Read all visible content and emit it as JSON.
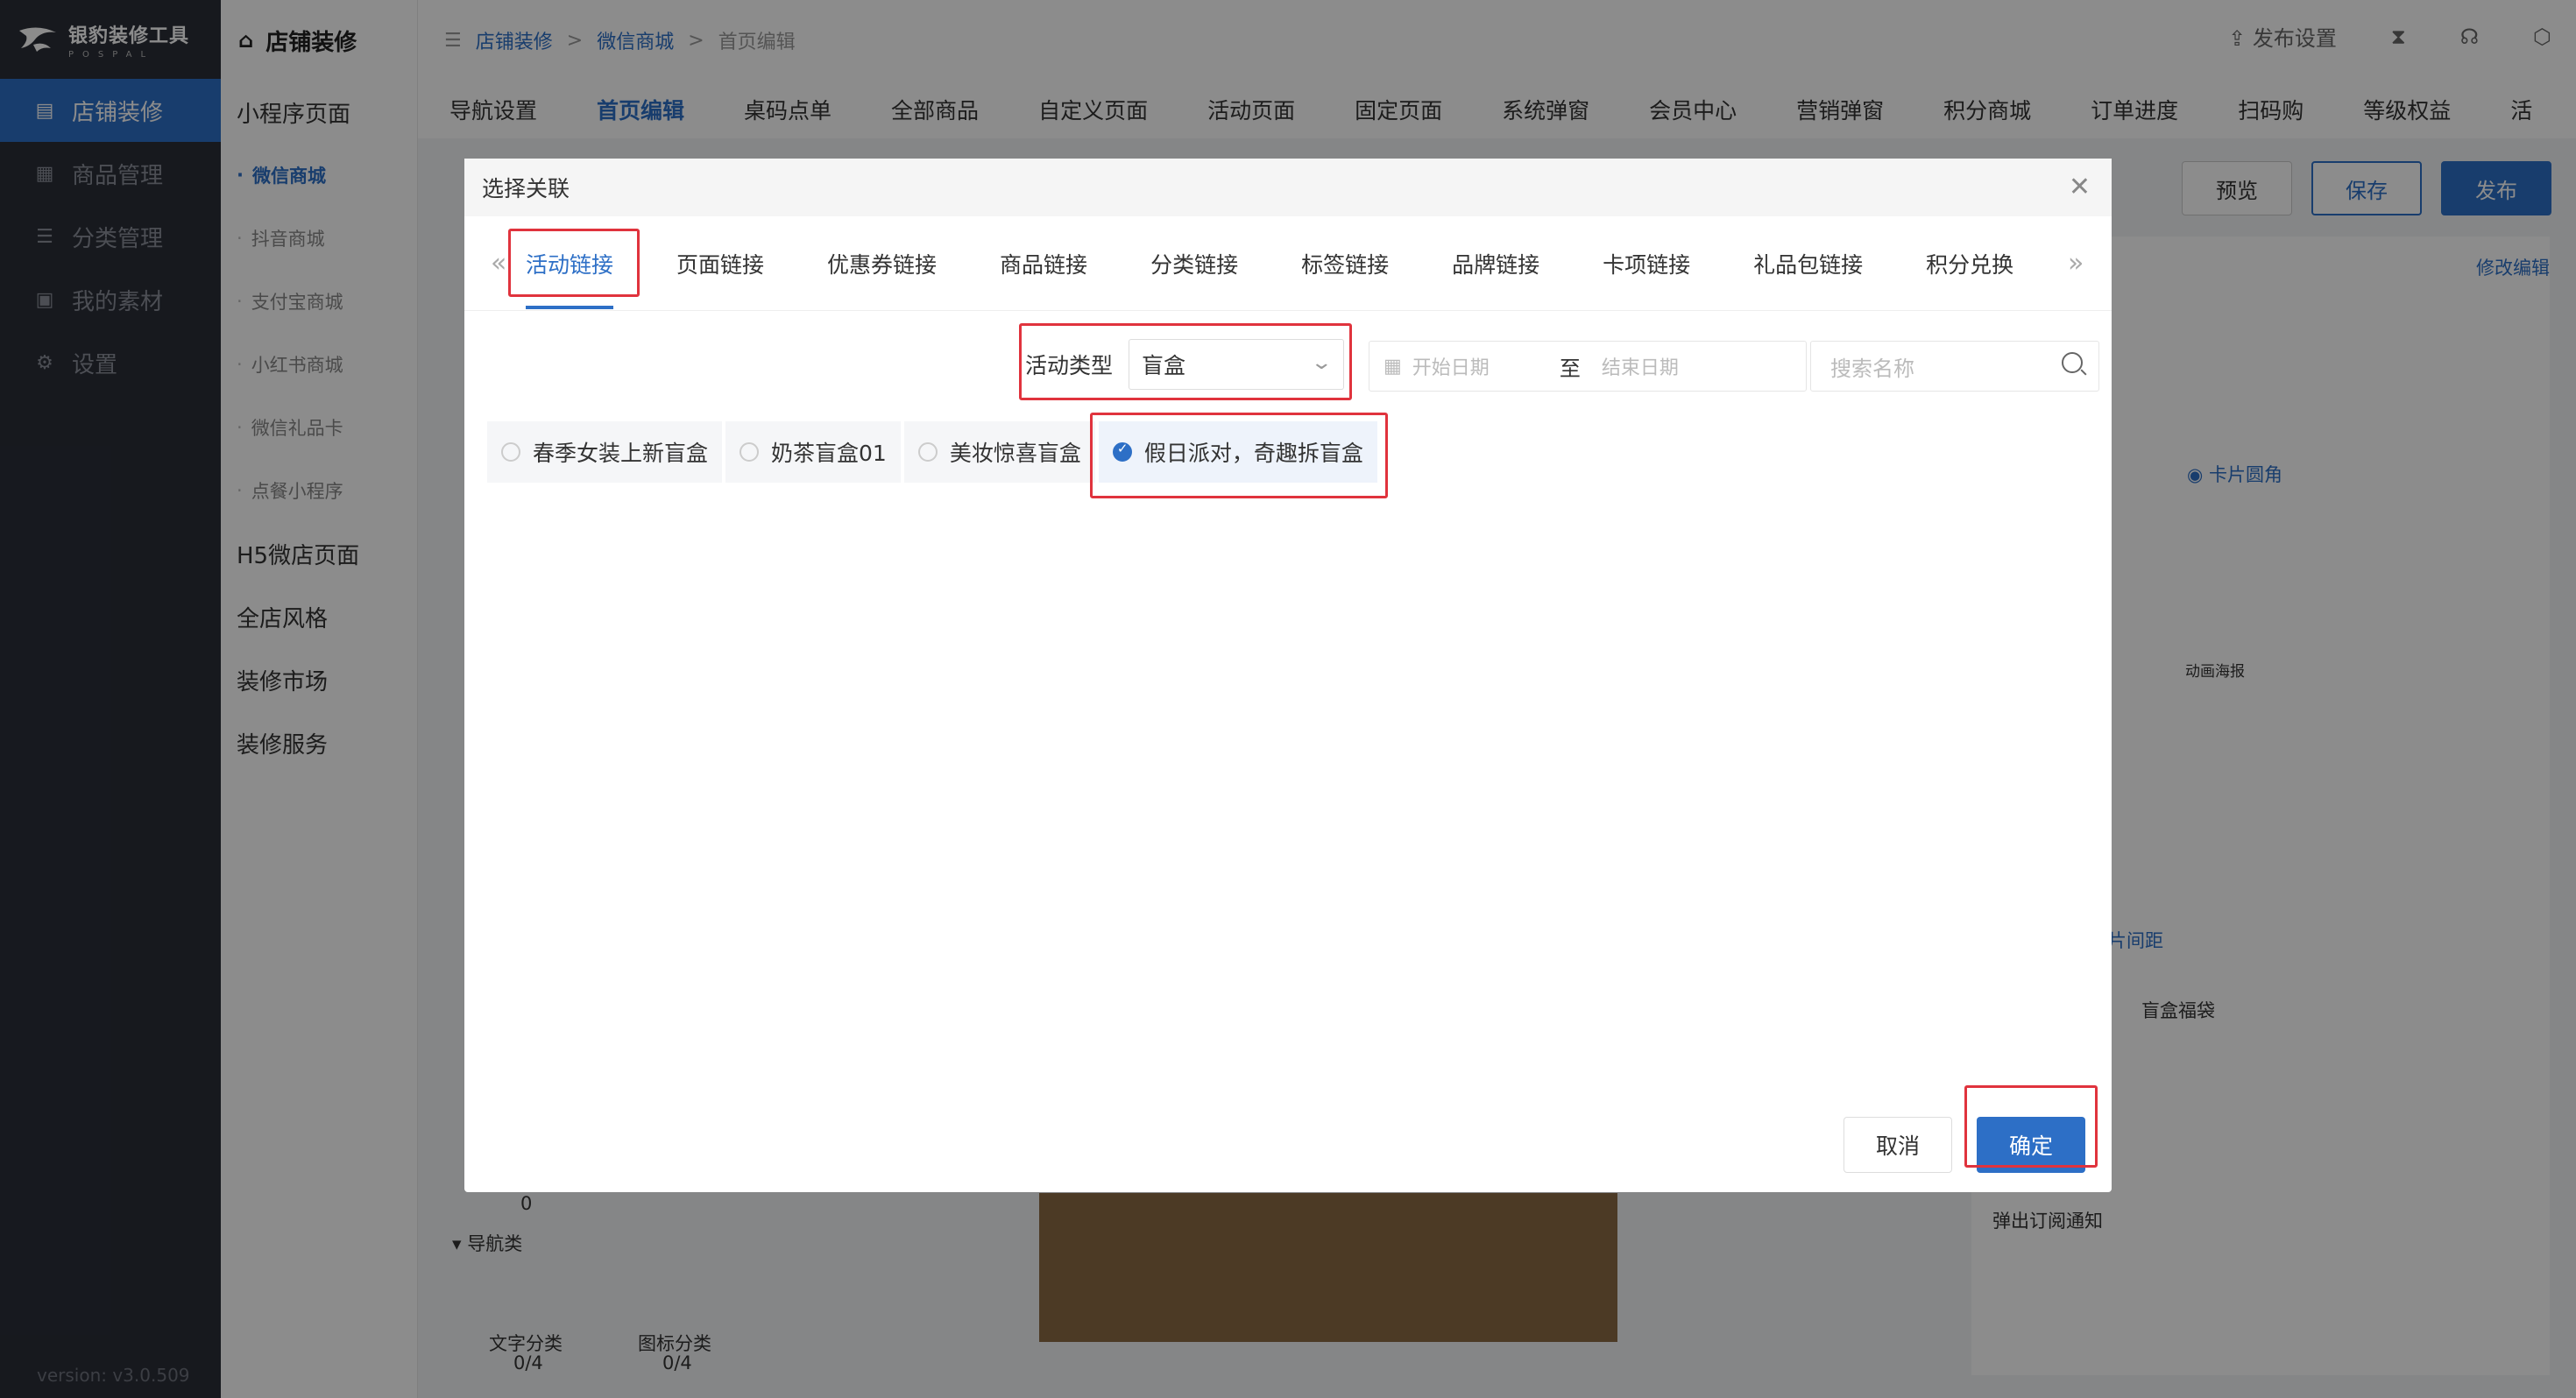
{
  "brand": {
    "name": "银豹装修工具",
    "sub": "POSPAL"
  },
  "sidebar": {
    "items": [
      {
        "label": "店铺装修",
        "icon": "store-icon"
      },
      {
        "label": "商品管理",
        "icon": "grid-icon"
      },
      {
        "label": "分类管理",
        "icon": "list-icon"
      },
      {
        "label": "我的素材",
        "icon": "image-icon"
      },
      {
        "label": "设置",
        "icon": "gear-icon"
      }
    ],
    "version": "version: v3.0.509"
  },
  "submenu": {
    "title": "店铺装修",
    "items": [
      {
        "label": "小程序页面"
      },
      {
        "label": "微信商城"
      },
      {
        "label": "抖音商城"
      },
      {
        "label": "支付宝商城"
      },
      {
        "label": "小红书商城"
      },
      {
        "label": "微信礼品卡"
      },
      {
        "label": "点餐小程序"
      },
      {
        "label": "H5微店页面"
      },
      {
        "label": "全店风格"
      },
      {
        "label": "装修市场"
      },
      {
        "label": "装修服务"
      }
    ]
  },
  "breadcrumb": {
    "l1": "店铺装修",
    "sep1": ">",
    "l2": "微信商城",
    "sep2": ">",
    "l3": "首页编辑"
  },
  "topActions": {
    "publishSettings": "发布设置"
  },
  "pageTabs": [
    "导航设置",
    "首页编辑",
    "桌码点单",
    "全部商品",
    "自定义页面",
    "活动页面",
    "固定页面",
    "系统弹窗",
    "会员中心",
    "营销弹窗",
    "积分商城",
    "订单进度",
    "扫码购",
    "等级权益",
    "活"
  ],
  "actionButtons": {
    "preview": "预览",
    "save": "保存",
    "publish": "发布"
  },
  "modal": {
    "title": "选择关联",
    "tabs": [
      "活动链接",
      "页面链接",
      "优惠券链接",
      "商品链接",
      "分类链接",
      "标签链接",
      "品牌链接",
      "卡项链接",
      "礼品包链接",
      "积分兑换"
    ],
    "filter": {
      "typeLabel": "活动类型",
      "typeValue": "盲盒",
      "startPlaceholder": "开始日期",
      "to": "至",
      "endPlaceholder": "结束日期",
      "searchPlaceholder": "搜索名称"
    },
    "options": [
      {
        "label": "春季女装上新盲盒",
        "checked": false
      },
      {
        "label": "奶茶盲盒01",
        "checked": false
      },
      {
        "label": "美妆惊喜盲盒",
        "checked": false
      },
      {
        "label": "假日派对，奇趣拆盲盒",
        "checked": true
      }
    ],
    "cancel": "取消",
    "confirm": "确定"
  },
  "peek": {
    "zero": "0",
    "navCategory": "导航类",
    "textCategory": "文字分类",
    "textCount": "0/4",
    "iconCategory": "图标分类",
    "iconCount": "0/4",
    "cardCorner": "卡片圆角",
    "animPoster": "动画海报",
    "modifyEdit": "修改编辑",
    "blindBag": "盲盒福袋",
    "subscribe": "弹出订阅通知",
    "imgSpacing": "片间距"
  }
}
